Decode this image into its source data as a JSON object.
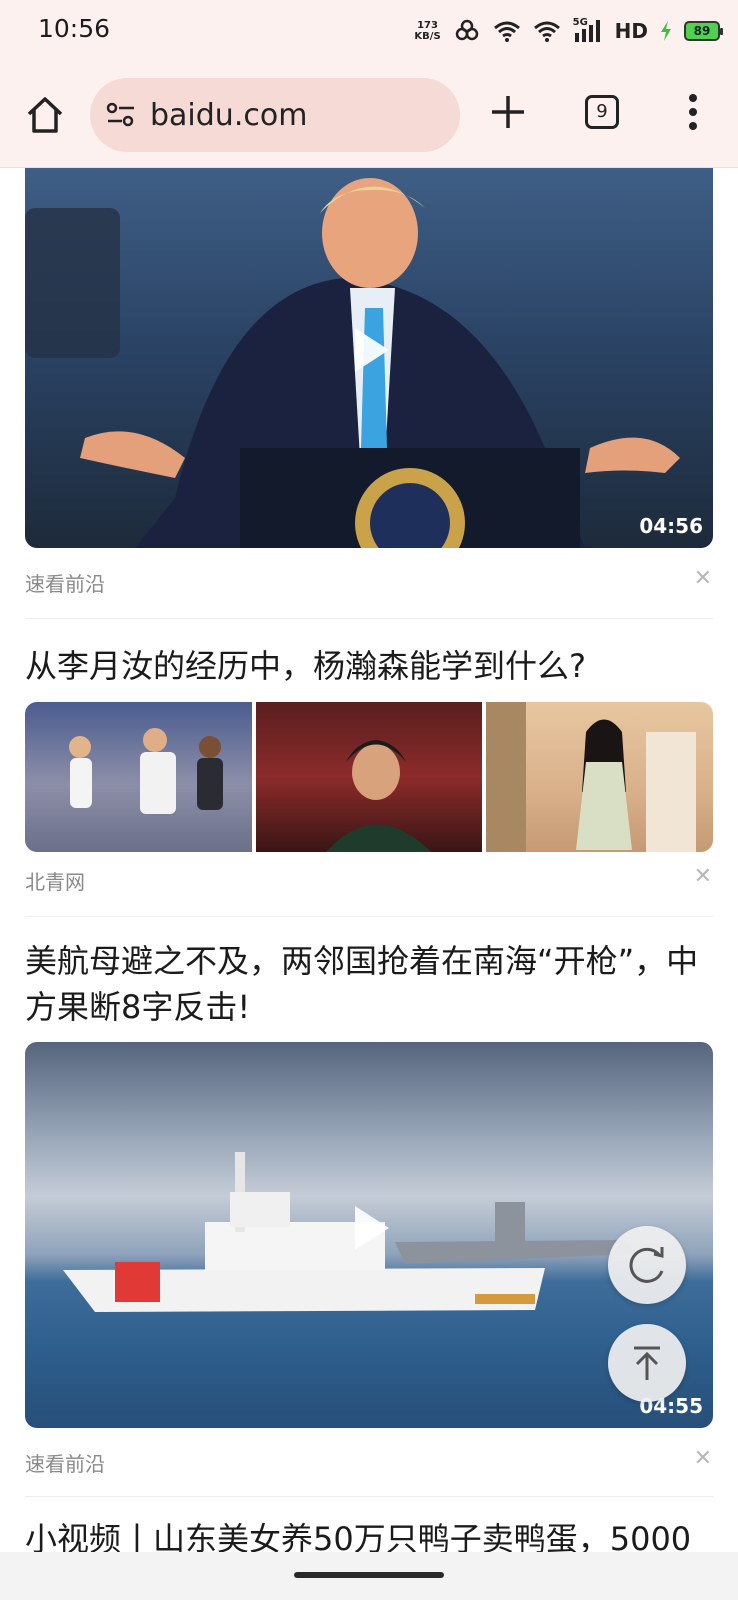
{
  "status": {
    "time": "10:56",
    "net_speed_value": "173",
    "net_speed_unit": "KB/S",
    "network": "5G",
    "hd": "HD",
    "battery": "89"
  },
  "browser": {
    "url": "baidu.com",
    "tab_count": "9"
  },
  "feed": [
    {
      "kind": "video",
      "duration": "04:56",
      "source": "速看前沿"
    },
    {
      "kind": "gallery",
      "title": "从李月汝的经历中，杨瀚森能学到什么?",
      "source": "北青网"
    },
    {
      "kind": "video",
      "title": "美航母避之不及，两邻国抢着在南海“开枪”，中方果断8字反击!",
      "duration": "04:55",
      "source": "速看前沿"
    },
    {
      "kind": "partial",
      "title": "小视频丨山东美女养50万只鸭子卖鸭蛋，5000"
    }
  ],
  "colors": {
    "chrome_bg": "#fcf1ee",
    "urlbar_bg": "#f5dad6",
    "battery_green": "#52d14f"
  }
}
